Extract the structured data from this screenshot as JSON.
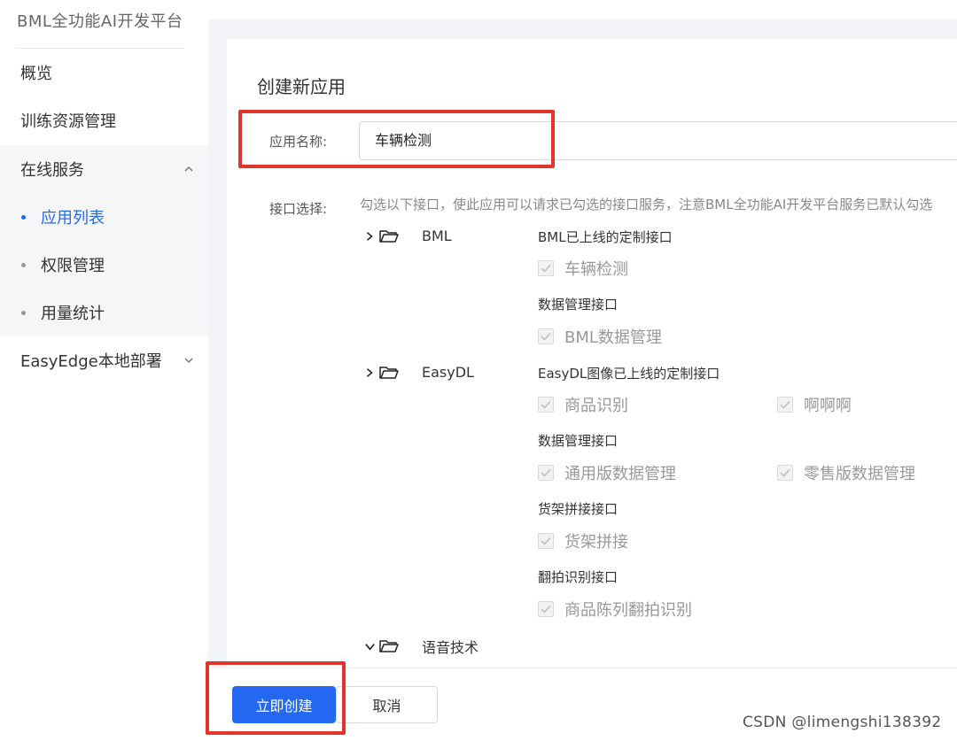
{
  "sidebar": {
    "brand": "BML全功能AI开发平台",
    "items": [
      {
        "label": "概览"
      },
      {
        "label": "训练资源管理"
      },
      {
        "label": "在线服务"
      },
      {
        "label": "EasyEdge本地部署"
      }
    ],
    "sub_items": [
      {
        "label": "应用列表",
        "active": true
      },
      {
        "label": "权限管理"
      },
      {
        "label": "用量统计"
      }
    ]
  },
  "form": {
    "title": "创建新应用",
    "name_label": "应用名称:",
    "name_value": "车辆检测",
    "api_label": "接口选择:",
    "hint": "勾选以下接口，使此应用可以请求已勾选的接口服务，注意BML全功能AI开发平台服务已默认勾选"
  },
  "tree": [
    {
      "name": "BML",
      "expanded": false,
      "groups": [
        {
          "title": "BML已上线的定制接口",
          "options": [
            "车辆检测"
          ]
        },
        {
          "title": "数据管理接口",
          "options": [
            "BML数据管理"
          ]
        }
      ]
    },
    {
      "name": "EasyDL",
      "expanded": false,
      "groups": [
        {
          "title": "EasyDL图像已上线的定制接口",
          "options": [
            "商品识别",
            "啊啊啊"
          ]
        },
        {
          "title": "数据管理接口",
          "options": [
            "通用版数据管理",
            "零售版数据管理"
          ]
        },
        {
          "title": "货架拼接接口",
          "options": [
            "货架拼接"
          ]
        },
        {
          "title": "翻拍识别接口",
          "options": [
            "商品陈列翻拍识别"
          ]
        }
      ]
    },
    {
      "name": "语音技术",
      "expanded": true,
      "groups": []
    }
  ],
  "footer": {
    "create_label": "立即创建",
    "cancel_label": "取消"
  },
  "watermark": "CSDN @limengshi138392",
  "colors": {
    "primary": "#2468f2",
    "annotation": "#e2342d"
  }
}
